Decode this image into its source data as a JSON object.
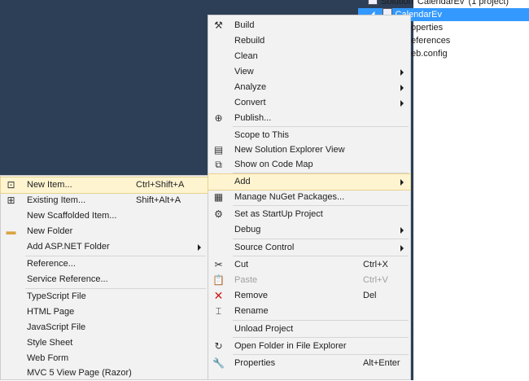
{
  "solution_explorer": {
    "solution_label": "Solution 'CalendarEv' (1 project)",
    "project_label": "CalendarEv",
    "items": [
      "operties",
      "eferences",
      "eb.config"
    ]
  },
  "context_menu": {
    "items": [
      {
        "label": "Build",
        "icon": "build-icon"
      },
      {
        "label": "Rebuild"
      },
      {
        "label": "Clean"
      },
      {
        "label": "View",
        "submenu": true
      },
      {
        "label": "Analyze",
        "submenu": true
      },
      {
        "label": "Convert",
        "submenu": true
      },
      {
        "label": "Publish...",
        "icon": "publish-icon"
      },
      {
        "label": "Scope to This"
      },
      {
        "label": "New Solution Explorer View",
        "icon": "new-view-icon"
      },
      {
        "label": "Show on Code Map",
        "icon": "code-map-icon"
      },
      {
        "label": "Add",
        "submenu": true,
        "highlighted": true
      },
      {
        "label": "Manage NuGet Packages...",
        "icon": "nuget-icon"
      },
      {
        "label": "Set as StartUp Project",
        "icon": "gear-icon"
      },
      {
        "label": "Debug",
        "submenu": true
      },
      {
        "label": "Source Control",
        "submenu": true
      },
      {
        "label": "Cut",
        "shortcut": "Ctrl+X",
        "icon": "scissors-icon"
      },
      {
        "label": "Paste",
        "shortcut": "Ctrl+V",
        "icon": "paste-icon",
        "disabled": true
      },
      {
        "label": "Remove",
        "shortcut": "Del",
        "icon": "remove-x-icon"
      },
      {
        "label": "Rename",
        "icon": "rename-icon"
      },
      {
        "label": "Unload Project"
      },
      {
        "label": "Open Folder in File Explorer",
        "icon": "open-folder-arrow-icon"
      },
      {
        "label": "Properties",
        "shortcut": "Alt+Enter",
        "icon": "wrench-icon"
      }
    ]
  },
  "add_submenu": {
    "items": [
      {
        "label": "New Item...",
        "shortcut": "Ctrl+Shift+A",
        "icon": "new-item-icon",
        "highlighted": true
      },
      {
        "label": "Existing Item...",
        "shortcut": "Shift+Alt+A",
        "icon": "existing-item-icon"
      },
      {
        "label": "New Scaffolded Item..."
      },
      {
        "label": "New Folder",
        "icon": "folder-icon"
      },
      {
        "label": "Add ASP.NET Folder",
        "submenu": true
      },
      {
        "label": "Reference..."
      },
      {
        "label": "Service Reference..."
      },
      {
        "label": "TypeScript File"
      },
      {
        "label": "HTML Page"
      },
      {
        "label": "JavaScript File"
      },
      {
        "label": "Style Sheet"
      },
      {
        "label": "Web Form"
      },
      {
        "label": "MVC 5 View Page (Razor)"
      }
    ]
  },
  "colors": {
    "editor_background": "#2d3f57",
    "menu_background": "#f2f2f2",
    "highlight": "#fff4d0",
    "selection": "#3399ff",
    "remove_icon": "#cc1a1a"
  }
}
